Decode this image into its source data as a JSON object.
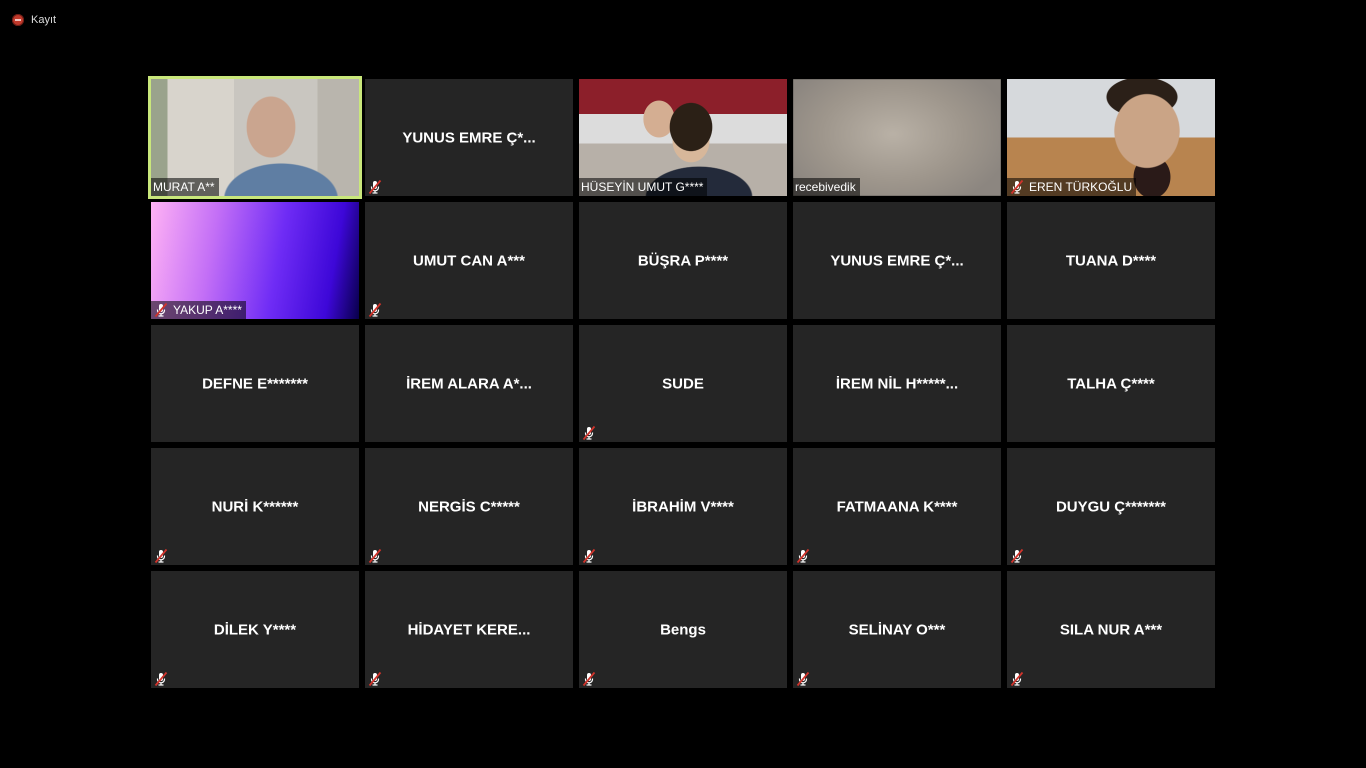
{
  "recording": {
    "label": "Kayıt"
  },
  "colors": {
    "active_speaker_border": "#c9e77b",
    "tile_background": "#252525",
    "muted_icon": "#d0342c"
  },
  "participants": [
    {
      "name": "MURAT A**",
      "video": "murat",
      "muted": false,
      "active": true
    },
    {
      "name": "YUNUS  EMRE  Ç*...",
      "video": null,
      "muted": true
    },
    {
      "name": "HÜSEYİN UMUT G****",
      "video": "huseyin",
      "muted": false
    },
    {
      "name": "recebivedik",
      "video": "recebi",
      "muted": false
    },
    {
      "name": "EREN TÜRKOĞLU",
      "video": "eren",
      "muted": true
    },
    {
      "name": "YAKUP  A****",
      "video": "yakup",
      "muted": true
    },
    {
      "name": "UMUT CAN A***",
      "video": null,
      "muted": true
    },
    {
      "name": "BÜŞRA P****",
      "video": null,
      "muted": false
    },
    {
      "name": "YUNUS  EMRE  Ç*...",
      "video": null,
      "muted": false
    },
    {
      "name": "TUANA D****",
      "video": null,
      "muted": false
    },
    {
      "name": "DEFNE E*******",
      "video": null,
      "muted": false
    },
    {
      "name": "İREM ALARA A*...",
      "video": null,
      "muted": false
    },
    {
      "name": "SUDE",
      "video": null,
      "muted": true
    },
    {
      "name": "İREM NİL H*****...",
      "video": null,
      "muted": false
    },
    {
      "name": "TALHA Ç****",
      "video": null,
      "muted": false
    },
    {
      "name": "NURİ K******",
      "video": null,
      "muted": true
    },
    {
      "name": "NERGİS C*****",
      "video": null,
      "muted": true
    },
    {
      "name": "İBRAHİM V****",
      "video": null,
      "muted": true
    },
    {
      "name": "FATMAANA K****",
      "video": null,
      "muted": true
    },
    {
      "name": "DUYGU Ç*******",
      "video": null,
      "muted": true
    },
    {
      "name": "DİLEK Y****",
      "video": null,
      "muted": true
    },
    {
      "name": "HİDAYET  KERE...",
      "video": null,
      "muted": true
    },
    {
      "name": "Bengs",
      "video": null,
      "muted": true
    },
    {
      "name": "SELİNAY O***",
      "video": null,
      "muted": true
    },
    {
      "name": "SILA NUR A***",
      "video": null,
      "muted": true
    }
  ]
}
